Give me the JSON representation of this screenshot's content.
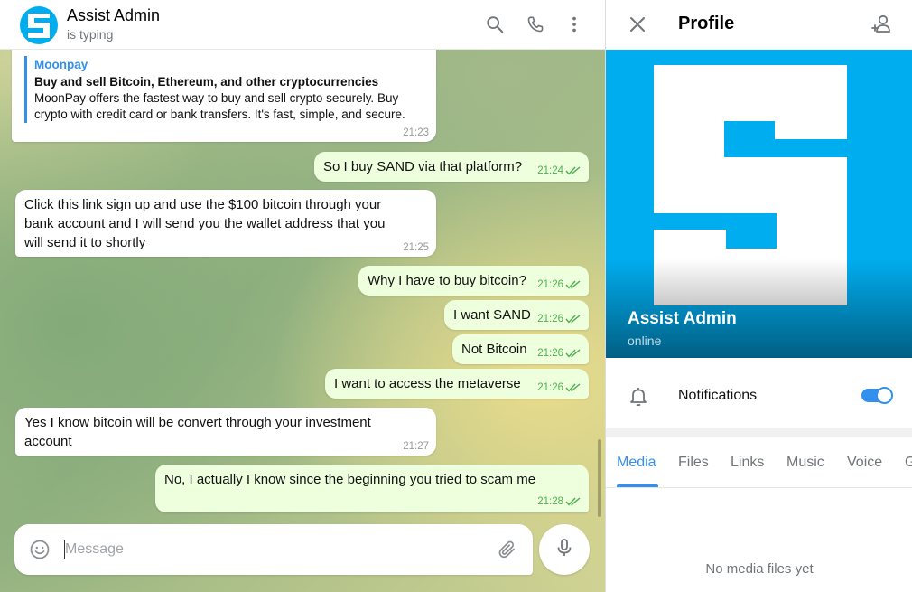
{
  "chat": {
    "title": "Assist Admin",
    "status": "is typing",
    "icons": [
      "search-icon",
      "phone-icon",
      "more-vertical-icon"
    ],
    "messages": [
      {
        "dir": "in",
        "link_preview": {
          "site": "Moonpay",
          "title": "Buy and sell Bitcoin, Ethereum, and other cryptocurrencies",
          "desc_line1": "MoonPay offers the fastest way to buy and sell crypto securely. Buy",
          "desc_line2": "crypto with credit card or bank transfers. It's fast, simple, and secure."
        },
        "time": "21:23"
      },
      {
        "dir": "out",
        "text": "So I buy SAND via that platform?",
        "time": "21:24",
        "read": true
      },
      {
        "dir": "in",
        "line1": "Click this link sign up and use the $100 bitcoin through your",
        "line2": "bank account and I will send you the wallet address that you",
        "line3": "will send it to shortly",
        "time": "21:25"
      },
      {
        "dir": "out",
        "text": "Why I have to buy bitcoin?",
        "time": "21:26",
        "read": true
      },
      {
        "dir": "out",
        "text": "I want SAND",
        "time": "21:26",
        "read": true
      },
      {
        "dir": "out",
        "text": "Not Bitcoin",
        "time": "21:26",
        "read": true
      },
      {
        "dir": "out",
        "text": "I want to access the metaverse",
        "time": "21:26",
        "read": true
      },
      {
        "dir": "in",
        "line1": "Yes I know bitcoin will be convert through your investment",
        "line2": "account",
        "time": "21:27"
      },
      {
        "dir": "out",
        "text": "No, I actually I know since the beginning you tried to scam me",
        "time": "21:28",
        "read": true
      }
    ],
    "composer": {
      "placeholder": "Message"
    }
  },
  "profile": {
    "title": "Profile",
    "name": "Assist Admin",
    "status": "online",
    "notifications_label": "Notifications",
    "notifications_on": true,
    "tabs": [
      "Media",
      "Files",
      "Links",
      "Music",
      "Voice",
      "G"
    ],
    "active_tab": "Media",
    "empty_text": "No media files yet"
  },
  "colors": {
    "accent": "#3390ec",
    "avatar_bg": "#00adef",
    "outgoing_bubble": "#eeffde",
    "read_ticks": "#4fae4e"
  }
}
